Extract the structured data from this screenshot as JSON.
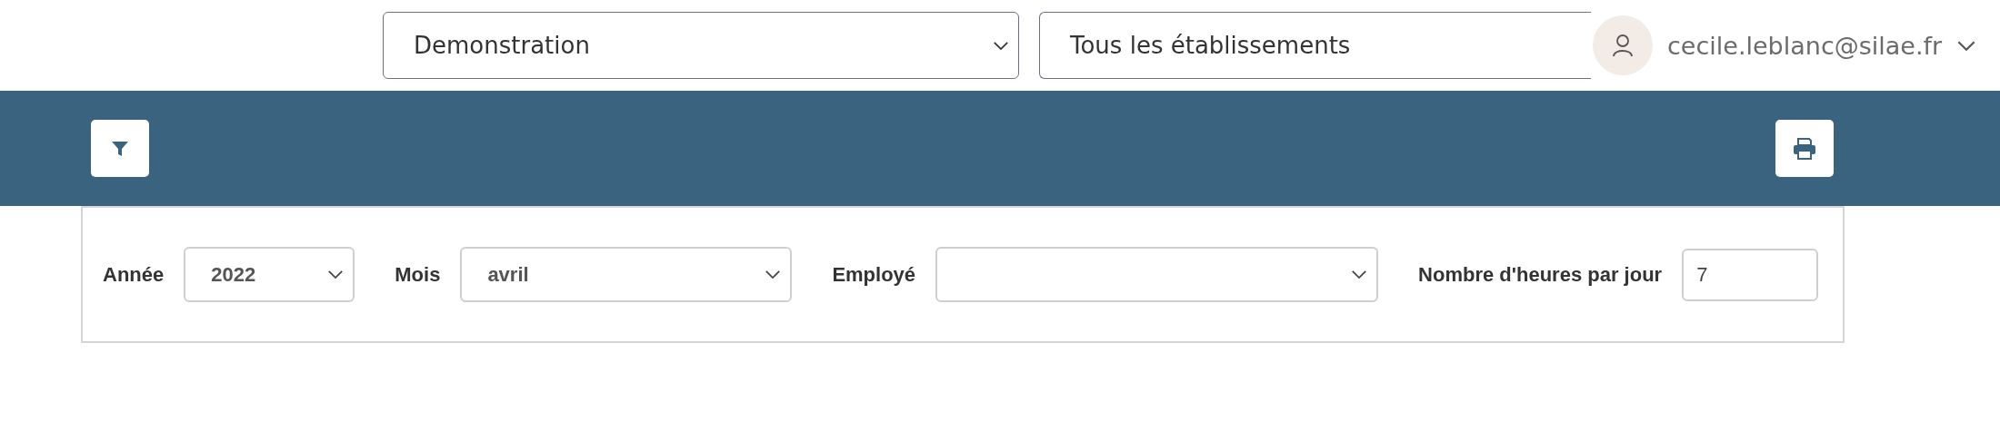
{
  "header": {
    "company_select": {
      "value": "Demonstration"
    },
    "establishment_select": {
      "value": "Tous les établissements"
    },
    "user": {
      "email": "cecile.leblanc@silae.fr"
    }
  },
  "toolbar": {
    "buttons": [
      {
        "kind": "filter"
      },
      {
        "kind": "print"
      }
    ]
  },
  "filters": [
    {
      "kind": "select",
      "label": "Année",
      "value": "2022"
    },
    {
      "kind": "select",
      "label": "Mois",
      "value": "avril"
    },
    {
      "kind": "select",
      "label": "Employé"
    },
    {
      "kind": "input",
      "label": "Nombre d'heures par jour",
      "value": "7"
    }
  ]
}
